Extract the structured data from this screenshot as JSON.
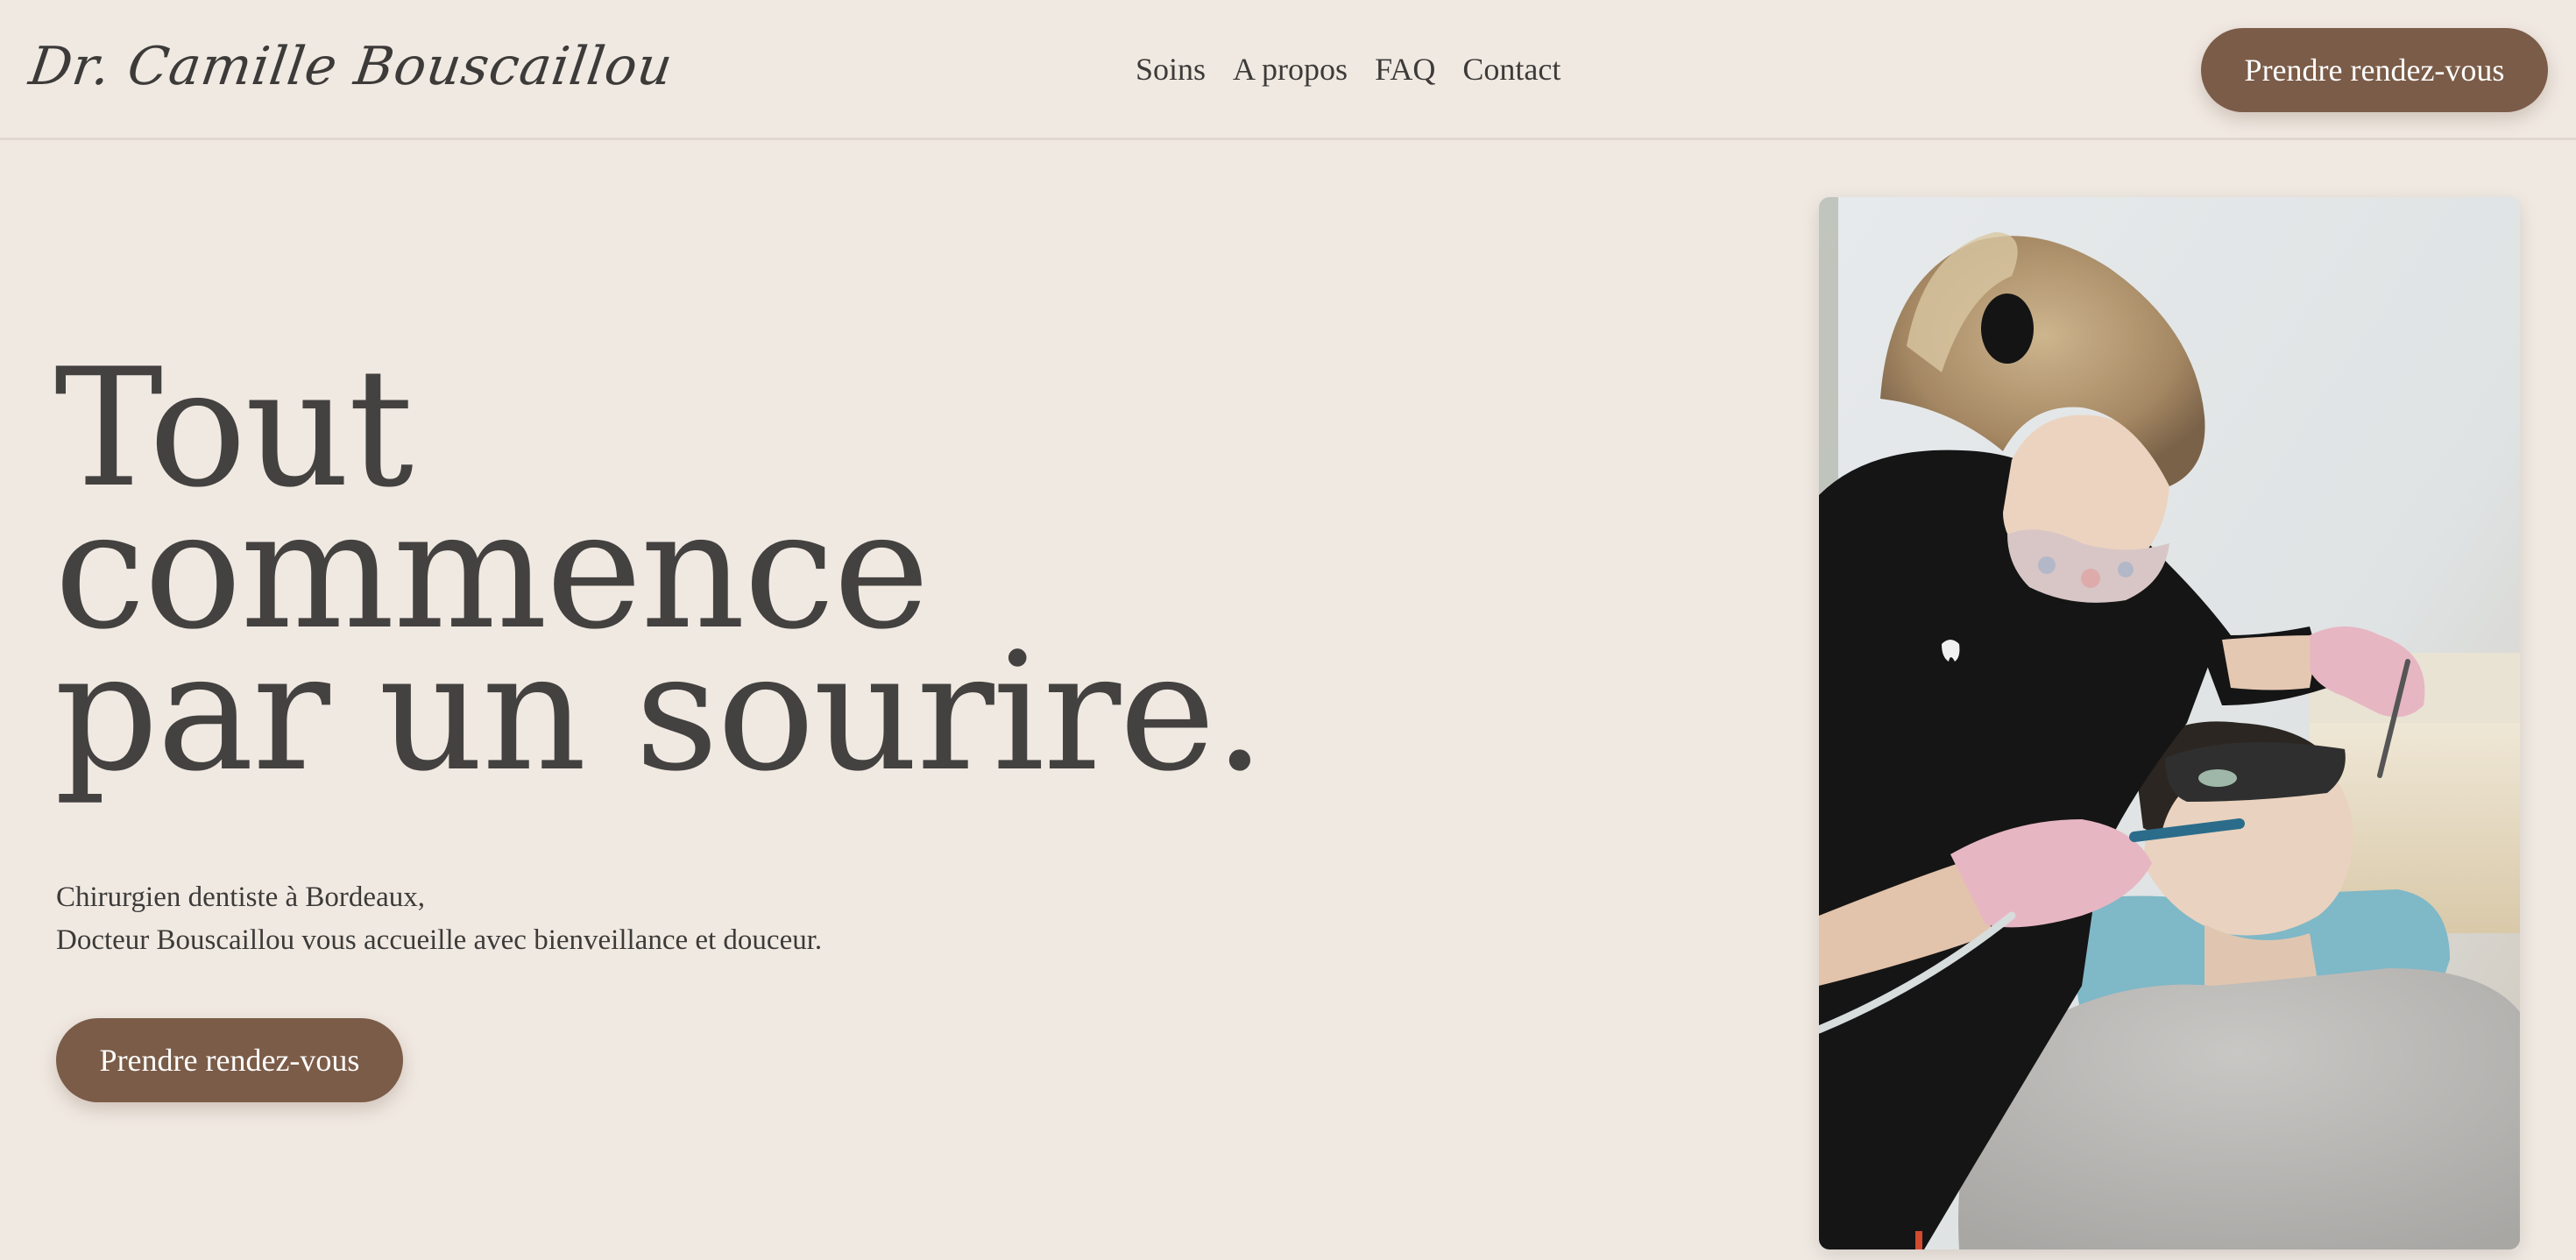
{
  "header": {
    "logo_text": "Dr. Camille Bouscaillou",
    "nav": [
      {
        "label": "Soins"
      },
      {
        "label": "A propos"
      },
      {
        "label": "FAQ"
      },
      {
        "label": "Contact"
      }
    ],
    "cta_label": "Prendre rendez-vous"
  },
  "hero": {
    "title_lines": [
      "Tout",
      "commence",
      "par un sourire."
    ],
    "subtitle_lines": [
      "Chirurgien dentiste à Bordeaux,",
      "Docteur Bouscaillou vous accueille avec bienveillance et douceur."
    ],
    "cta_label": "Prendre rendez-vous",
    "photo_alt": "dentist-treating-patient-photo"
  },
  "colors": {
    "background": "#f0e9e2",
    "accent_button": "#7b5c48",
    "text": "#444240"
  }
}
